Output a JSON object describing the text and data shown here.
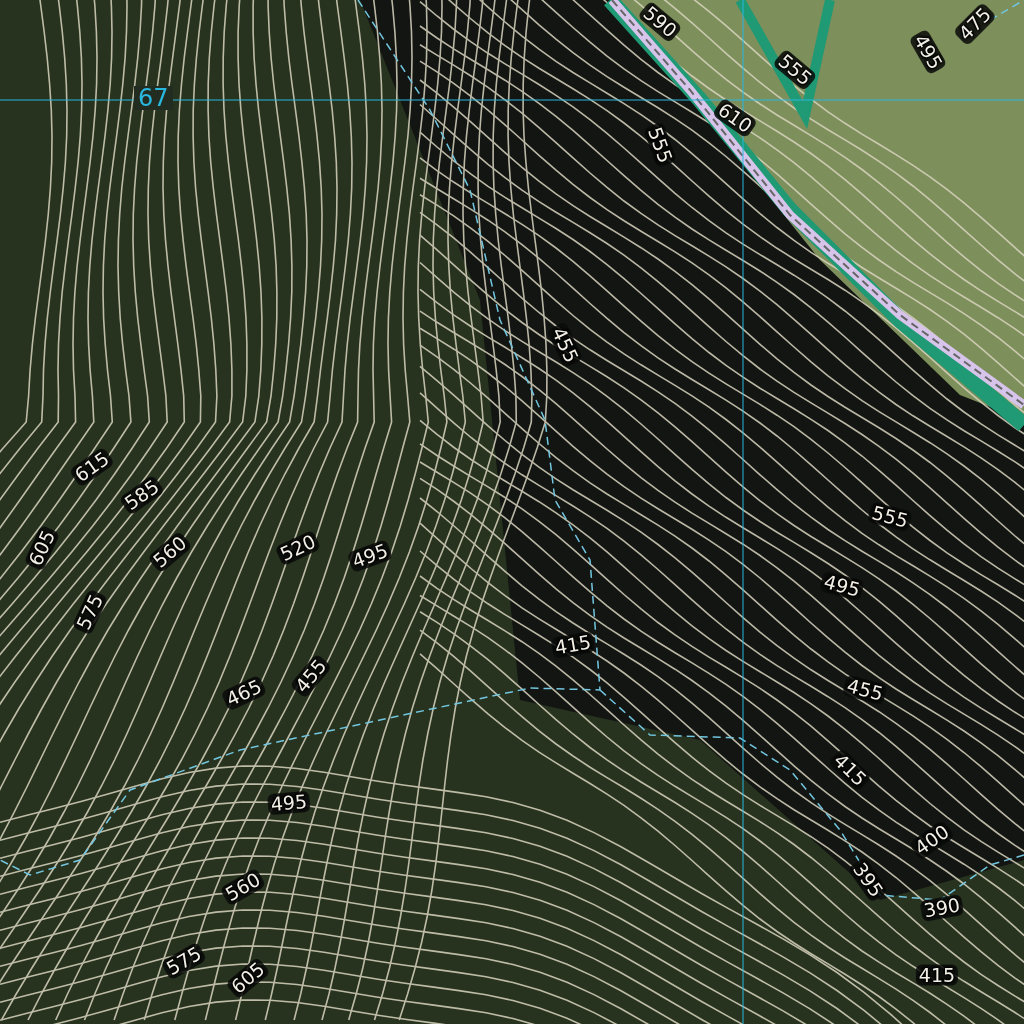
{
  "map": {
    "grid_label": "67",
    "contour_labels": [
      "590",
      "475",
      "495",
      "555",
      "610",
      "555",
      "455",
      "615",
      "585",
      "605",
      "560",
      "520",
      "495",
      "575",
      "415",
      "465",
      "455",
      "555",
      "495",
      "455",
      "415",
      "400",
      "495",
      "395",
      "390",
      "560",
      "575",
      "605",
      "415"
    ]
  }
}
